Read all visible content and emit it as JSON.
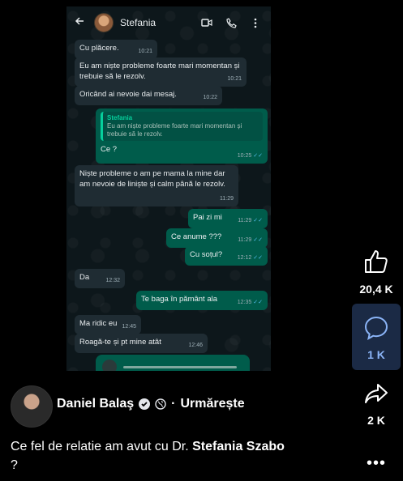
{
  "chat": {
    "contact_name": "Stefania",
    "messages": [
      {
        "dir": "in",
        "text": "Cu plăcere.",
        "time": "10:21"
      },
      {
        "dir": "in",
        "text": "Eu am niște probleme foarte mari momentan și trebuie să le rezolv.",
        "time": "10:21"
      },
      {
        "dir": "in",
        "text": "Oricând ai nevoie dai mesaj.",
        "time": "10:22"
      },
      {
        "dir": "out",
        "quote_name": "Stefania",
        "quote_text": "Eu am niște probleme foarte mari momentan și trebuie să le rezolv.",
        "text": "Ce ?",
        "time": "10:25"
      },
      {
        "dir": "in",
        "text": "Niște probleme o am pe mama la mine dar am nevoie de liniște și calm până le rezolv.",
        "time": "11:29"
      },
      {
        "dir": "out",
        "text": "Pai zi mi",
        "time": "11:29"
      },
      {
        "dir": "out",
        "text": "Ce anume ???",
        "time": "11:29"
      },
      {
        "dir": "out",
        "text": "Cu soțul?",
        "time": "12:12"
      },
      {
        "dir": "in",
        "text": "Da",
        "time": "12:32"
      },
      {
        "dir": "out",
        "text": "Te baga în pământ ala",
        "time": "12:35"
      },
      {
        "dir": "in",
        "text": "Ma ridic eu",
        "time": "12:45"
      },
      {
        "dir": "in",
        "text": "Roagă-te și pt mine atât",
        "time": "12:46"
      }
    ]
  },
  "actions": {
    "likes": "20,4 K",
    "comments": "1 K",
    "shares": "2 K"
  },
  "author": {
    "name": "Daniel Balaş",
    "separator": "·",
    "follow_label": "Urmărește"
  },
  "caption": {
    "prefix": "Ce fel de relatie am avut cu Dr. ",
    "highlight": "Stefania Szabo",
    "suffix": "?"
  },
  "more_label": "•••",
  "colors": {
    "incoming_bubble": "#1f2c33",
    "outgoing_bubble": "#005c4b",
    "read_ticks": "#53bdeb",
    "comment_active_bg": "#1b2a45"
  }
}
